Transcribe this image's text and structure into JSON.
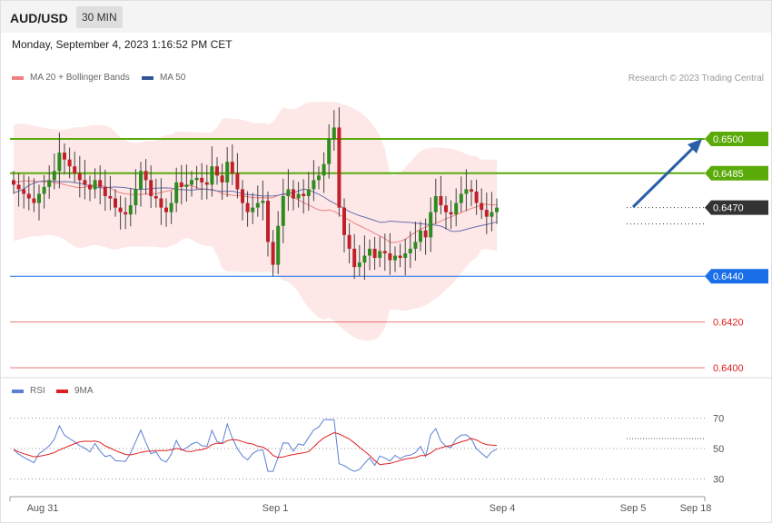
{
  "header": {
    "pair": "AUD/USD",
    "timeframe": "30 MIN",
    "datetime": "Monday, September 4, 2023 1:16:52 PM CET"
  },
  "legend": {
    "ma": "MA 20 + Bollinger Bands",
    "ma50": "MA 50",
    "credit": "Research © 2023 Trading Central",
    "ma_color": "#f08080",
    "ma50_color": "#2f5597"
  },
  "rsi_legend": {
    "rsi": "RSI",
    "ma9": "9MA",
    "rsi_color": "#5b7fd6",
    "ma9_color": "#e02020"
  },
  "chart_data": [
    {
      "type": "candlestick",
      "ylim": [
        0.6392,
        0.6528
      ],
      "levels": [
        {
          "label": "0.6500",
          "value": 0.65,
          "color": "#5aaa0a",
          "kind": "resistance"
        },
        {
          "label": "0.6485",
          "value": 0.6485,
          "color": "#5aaa0a",
          "kind": "resistance"
        },
        {
          "label": "0.6470",
          "value": 0.647,
          "color": "#333333",
          "kind": "current"
        },
        {
          "label": "0.6440",
          "value": 0.644,
          "color": "#1a6fe8",
          "kind": "pivot"
        },
        {
          "label": "0.6420",
          "value": 0.642,
          "color": "#e02020",
          "kind": "support"
        },
        {
          "label": "0.6400",
          "value": 0.64,
          "color": "#e02020",
          "kind": "support"
        }
      ],
      "x_ticks": [
        "Aug 31",
        "Sep 1",
        "Sep 4",
        "Sep 5",
        "Sep 18"
      ],
      "close_path": [
        0.648,
        0.6478,
        0.6476,
        0.6474,
        0.6472,
        0.6476,
        0.6479,
        0.6482,
        0.6486,
        0.6494,
        0.6491,
        0.6488,
        0.6485,
        0.6482,
        0.648,
        0.6478,
        0.6482,
        0.6479,
        0.6475,
        0.6474,
        0.647,
        0.6468,
        0.6467,
        0.6471,
        0.6478,
        0.6486,
        0.6482,
        0.6475,
        0.6474,
        0.647,
        0.6468,
        0.6472,
        0.6481,
        0.6479,
        0.648,
        0.6482,
        0.6483,
        0.6481,
        0.648,
        0.6488,
        0.6484,
        0.6481,
        0.649,
        0.6485,
        0.6478,
        0.6472,
        0.6468,
        0.647,
        0.6472,
        0.6473,
        0.6455,
        0.6445,
        0.6462,
        0.6475,
        0.6478,
        0.6474,
        0.6476,
        0.6475,
        0.6478,
        0.6482,
        0.6484,
        0.6489,
        0.65,
        0.6505,
        0.647,
        0.6458,
        0.6452,
        0.6444,
        0.6446,
        0.6449,
        0.6452,
        0.6448,
        0.6451,
        0.645,
        0.6447,
        0.6449,
        0.6448,
        0.645,
        0.6452,
        0.6455,
        0.646,
        0.6457,
        0.6468,
        0.6475,
        0.6471,
        0.6468,
        0.6467,
        0.6472,
        0.6476,
        0.6478,
        0.6477,
        0.6472,
        0.6469,
        0.6466,
        0.6468,
        0.647
      ],
      "rsi": {
        "ylim": [
          20,
          80
        ],
        "levels": [
          70,
          50,
          30
        ]
      }
    }
  ]
}
